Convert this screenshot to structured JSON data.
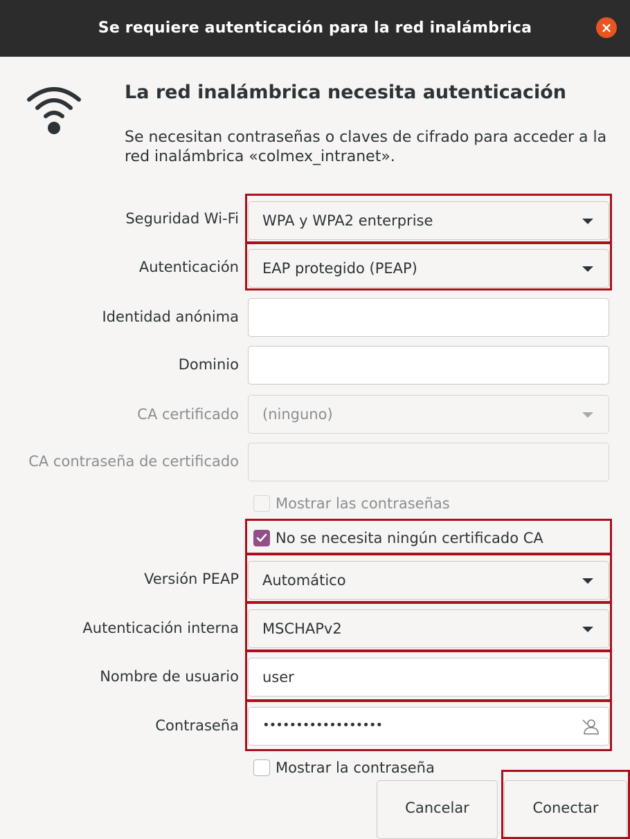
{
  "window": {
    "title": "Se requiere autenticación para la red inalámbrica",
    "close_label": "×"
  },
  "header": {
    "heading": "La red inalámbrica necesita autenticación",
    "description": "Se necesitan contraseñas o claves de cifrado para acceder a la red inalámbrica «colmex_intranet»."
  },
  "form": {
    "wifi_security": {
      "label": "Seguridad Wi-Fi",
      "value": "WPA y WPA2 enterprise"
    },
    "authentication": {
      "label": "Autenticación",
      "value": "EAP protegido (PEAP)"
    },
    "anonymous_identity": {
      "label": "Identidad anónima",
      "value": ""
    },
    "domain": {
      "label": "Dominio",
      "value": ""
    },
    "ca_certificate": {
      "label": "CA certificado",
      "value": "(ninguno)"
    },
    "ca_cert_password": {
      "label": "CA contraseña de certificado",
      "value": ""
    },
    "show_passwords": {
      "label": "Mostrar las contraseñas",
      "checked": false
    },
    "no_ca_required": {
      "label": "No se necesita ningún certificado CA",
      "checked": true
    },
    "peap_version": {
      "label": "Versión PEAP",
      "value": "Automático"
    },
    "inner_auth": {
      "label": "Autenticación interna",
      "value": "MSCHAPv2"
    },
    "username": {
      "label": "Nombre de usuario",
      "value": "user"
    },
    "password": {
      "label": "Contraseña",
      "value": "••••••••••••••••••"
    },
    "show_password": {
      "label": "Mostrar la contraseña",
      "checked": false
    }
  },
  "buttons": {
    "cancel": "Cancelar",
    "connect": "Conectar"
  },
  "colors": {
    "titlebar": "#2c2c2c",
    "close_button": "#e95420",
    "checkbox_checked": "#924d8b",
    "highlight_annotation": "#a8101c"
  }
}
